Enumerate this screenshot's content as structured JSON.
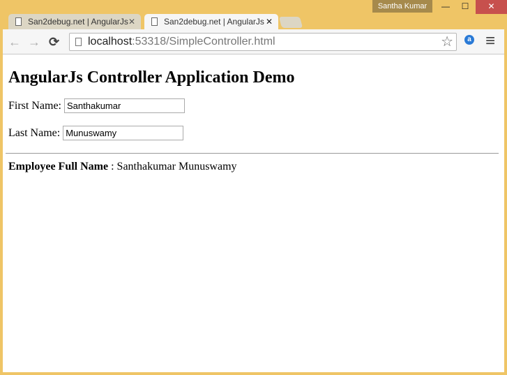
{
  "window": {
    "user": "Santha Kumar",
    "minimize": "—",
    "maximize": "☐",
    "close": "✕"
  },
  "tabs": [
    {
      "label": "San2debug.net | AngularJs",
      "close": "✕"
    },
    {
      "label": "San2debug.net | AngularJs",
      "close": "✕"
    }
  ],
  "address": {
    "host": "localhost",
    "rest": ":53318/SimpleController.html"
  },
  "icons": {
    "back": "←",
    "forward": "→",
    "reload": "⟳",
    "star": "☆",
    "menu": "≡",
    "ext": "a"
  },
  "page": {
    "title": "AngularJs Controller Application Demo",
    "first_label": "First Name:",
    "first_value": "Santhakumar",
    "last_label": "Last Name:",
    "last_value": "Munuswamy",
    "full_label": "Employee Full Name",
    "full_sep": " : ",
    "full_value": "Santhakumar Munuswamy"
  }
}
